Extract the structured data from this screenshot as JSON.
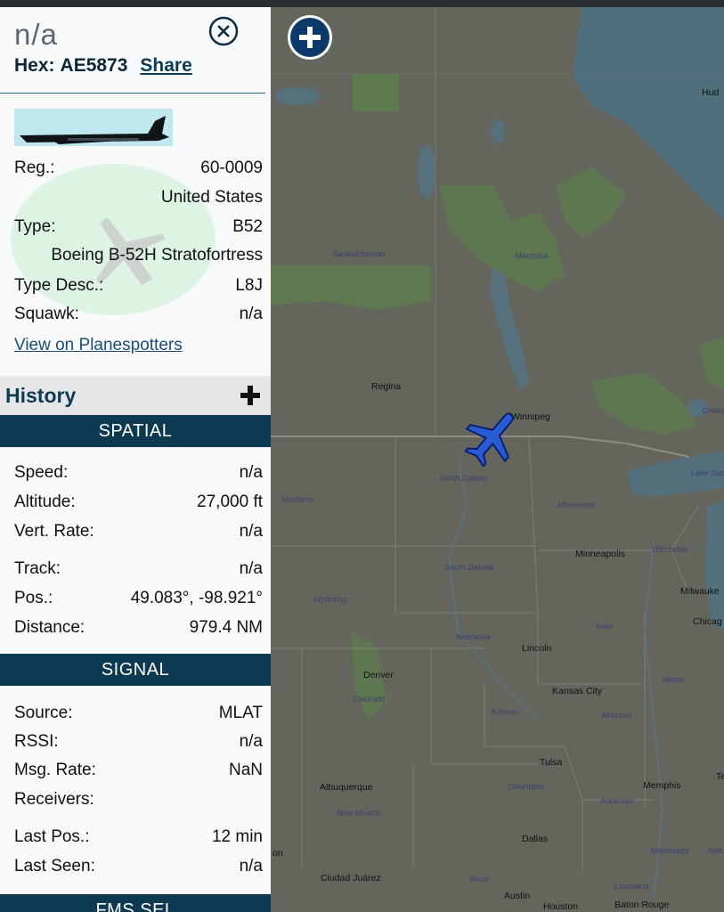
{
  "panel": {
    "title": "n/a",
    "hex_label": "Hex:",
    "hex_value": "AE5873",
    "share_label": "Share",
    "details": {
      "reg_label": "Reg.:",
      "reg_value": "60-0009",
      "country": "United States",
      "type_label": "Type:",
      "type_value": "B52",
      "model": "Boeing B-52H Stratofortress",
      "typedesc_label": "Type Desc.:",
      "typedesc_value": "L8J",
      "squawk_label": "Squawk:",
      "squawk_value": "n/a",
      "link_label": "View on Planespotters"
    },
    "history_label": "History",
    "spatial": {
      "header": "SPATIAL",
      "speed_label": "Speed:",
      "speed_value": "n/a",
      "altitude_label": "Altitude:",
      "altitude_value": "27,000 ft",
      "vert_label": "Vert. Rate:",
      "vert_value": "n/a",
      "track_label": "Track:",
      "track_value": "n/a",
      "pos_label": "Pos.:",
      "pos_value": "49.083°, -98.921°",
      "distance_label": "Distance:",
      "distance_value": "979.4 NM"
    },
    "signal": {
      "header": "SIGNAL",
      "source_label": "Source:",
      "source_value": "MLAT",
      "rssi_label": "RSSI:",
      "rssi_value": "n/a",
      "msg_label": "Msg. Rate:",
      "msg_value": "NaN",
      "receivers_label": "Receivers:",
      "lastpos_label": "Last Pos.:",
      "lastpos_value": "12 min",
      "lastseen_label": "Last Seen:",
      "lastseen_value": "n/a"
    },
    "next_section_header": "FMS SEL"
  },
  "map": {
    "labels": {
      "hud": "Hud",
      "saskatchewan": "Saskatchewan",
      "manitoba": "Manitoba",
      "regina": "Regina",
      "winnipeg": "Winnipeg",
      "ontario": "Ontari",
      "lake_superior": "Lake Superi",
      "montana": "Montana",
      "north_dakota": "North Dakota",
      "minnesota": "Minnesota",
      "minneapolis": "Minneapolis",
      "wisconsin": "Wisconsin",
      "milwaukee": "Milwauke",
      "south_dakota": "South Dakota",
      "wyoming": "Wyoming",
      "iowa": "Iowa",
      "chicago": "Chicag",
      "nebraska": "Nebraska",
      "lincoln": "Lincoln",
      "denver": "Denver",
      "colorado": "Colorado",
      "illinois": "Illinois",
      "kansas_city": "Kansas City",
      "kansas": "Kansas",
      "missouri": "Missouri",
      "tulsa": "Tulsa",
      "albuquerque": "Albuquerque",
      "oklahoma": "Oklahoma",
      "memphis": "Memphis",
      "arkansas": "Arkansas",
      "new_mexico": "New Mexico",
      "dallas": "Dallas",
      "mississippi": "Mississippi",
      "alab": "Alab",
      "on": "on",
      "ciudad_juarez": "Ciudad Juárez",
      "texas": "Texas",
      "austin": "Austin",
      "louisiana": "Louisiana",
      "houston": "Houston",
      "baton_rouge": "Baton Rouge",
      "te": "Te"
    },
    "colors": {
      "plane": "#2a5bd7",
      "section": "#0d3a50",
      "zoom": "#0b3a6a"
    }
  }
}
